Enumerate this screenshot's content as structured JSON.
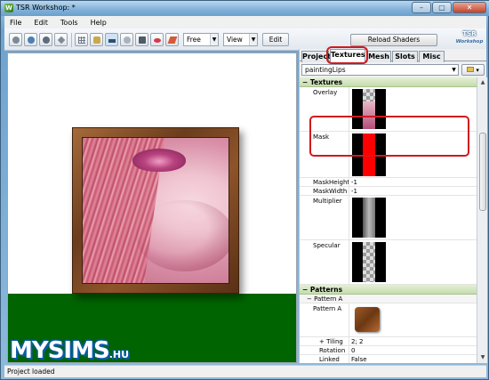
{
  "window": {
    "title": "TSR Workshop: *",
    "controls": [
      "–",
      "▢",
      "✕"
    ]
  },
  "menu": [
    "File",
    "Edit",
    "Tools",
    "Help"
  ],
  "toolbar": {
    "mode_select": "Free",
    "view_select": "View",
    "edit_label": "Edit",
    "reload_label": "Reload Shaders",
    "logo_text": "TSR",
    "logo_sub": "Workshop"
  },
  "panel": {
    "tabs": [
      "Project",
      "Textures",
      "Mesh",
      "Slots",
      "Misc"
    ],
    "active_tab": "Textures",
    "combo_value": "paintingLips",
    "sections": {
      "textures": "Textures",
      "patterns": "Patterns"
    },
    "rows": {
      "overlay": "Overlay",
      "mask": "Mask",
      "mask_height_label": "MaskHeight",
      "mask_height_value": "-1",
      "mask_width_label": "MaskWidth",
      "mask_width_value": "-1",
      "multiplier": "Multiplier",
      "specular": "Specular",
      "pattern_group": "Pattern A",
      "pattern_item": "Pattern A",
      "tiling_label": "Tiling",
      "tiling_value": "2; 2",
      "rotation_label": "Rotation",
      "rotation_value": "0",
      "linked_label": "Linked",
      "linked_value": "False"
    }
  },
  "watermark": {
    "main": "MYSIMS",
    "suffix": ".HU"
  },
  "status": "Project loaded",
  "colors": {
    "highlight": "#d0191e",
    "floor": "#006400",
    "mask_red": "#ff0000"
  }
}
